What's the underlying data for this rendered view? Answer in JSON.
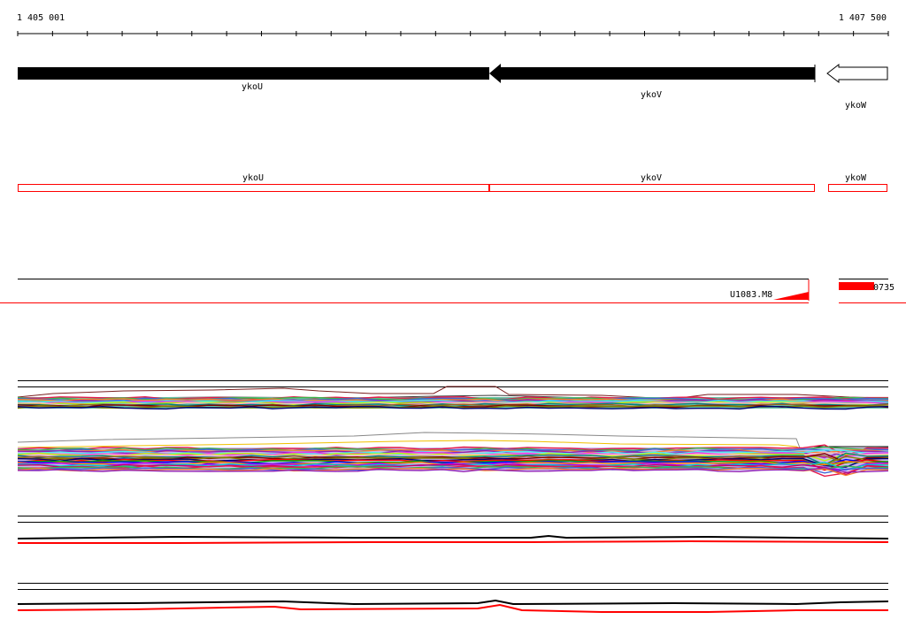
{
  "ruler": {
    "start_label": "1 405 001",
    "end_label": "1 407 500"
  },
  "genes": [
    {
      "name": "ykoU",
      "strand": "minus",
      "style": "filled"
    },
    {
      "name": "ykoV",
      "strand": "minus",
      "style": "filled"
    },
    {
      "name": "ykoW",
      "strand": "minus",
      "style": "outline"
    }
  ],
  "annotated_regions": [
    {
      "name": "ykoU"
    },
    {
      "name": "ykoV"
    },
    {
      "name": "ykoW"
    }
  ],
  "features": [
    {
      "name": "U1083.M8"
    },
    {
      "name": "0735"
    }
  ],
  "colors": {
    "gene": "#000000",
    "region": "#ff0000",
    "feature": "#ff0000",
    "track_lines": "#000000",
    "baseline": "#ff0000"
  }
}
